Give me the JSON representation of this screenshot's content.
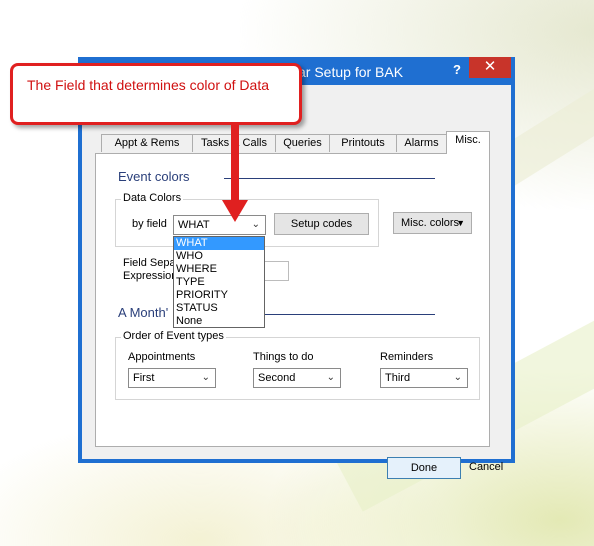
{
  "window": {
    "title": "ar Setup for BAK",
    "help_glyph": "?",
    "close_glyph": "✕"
  },
  "callout": {
    "text": "The Field that determines color of Data"
  },
  "tabs": [
    {
      "label": "Appt & Rems"
    },
    {
      "label": "Tasks & Calls"
    },
    {
      "label": "Queries"
    },
    {
      "label": "Printouts"
    },
    {
      "label": "Alarms"
    },
    {
      "label": "Misc."
    }
  ],
  "event_colors": {
    "title": "Event colors",
    "data_colors": {
      "label": "Data Colors",
      "by_field_label": "by field",
      "by_field_value": "WHAT",
      "setup_codes": "Setup codes",
      "options": [
        "WHAT",
        "WHO",
        "WHERE",
        "TYPE",
        "PRIORITY",
        "STATUS",
        "None"
      ]
    },
    "misc_colors": "Misc. colors"
  },
  "field_separator": {
    "line1": "Field Sepa",
    "line2": "Expression"
  },
  "months": {
    "title": "A Month'"
  },
  "order": {
    "label": "Order of Event types",
    "appointments": {
      "label": "Appointments",
      "value": "First"
    },
    "things": {
      "label": "Things to do",
      "value": "Second"
    },
    "reminders": {
      "label": "Reminders",
      "value": "Third"
    }
  },
  "buttons": {
    "done": "Done",
    "cancel": "Cancel"
  },
  "colors": {
    "accent": "#1f6fd1",
    "callout_border": "#e02020",
    "selection": "#3399ff"
  }
}
